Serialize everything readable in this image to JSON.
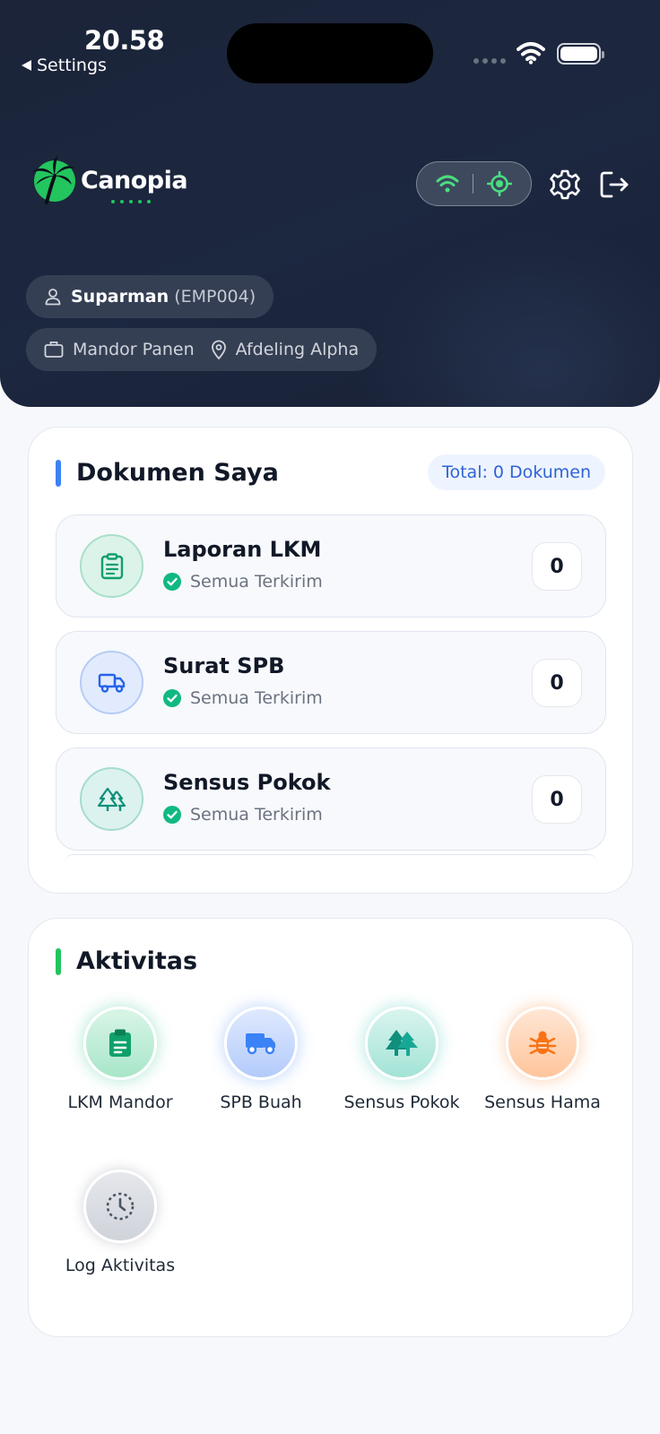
{
  "status_bar": {
    "time": "20.58",
    "back_label": "Settings"
  },
  "app": {
    "name": "Canopia"
  },
  "user": {
    "name": "Suparman",
    "employee_id": "(EMP004)",
    "role": "Mandor Panen",
    "location": "Afdeling Alpha"
  },
  "documents": {
    "title": "Dokumen Saya",
    "total_label": "Total: 0 Dokumen",
    "items": [
      {
        "title": "Laporan LKM",
        "status": "Semua Terkirim",
        "count": "0"
      },
      {
        "title": "Surat SPB",
        "status": "Semua Terkirim",
        "count": "0"
      },
      {
        "title": "Sensus Pokok",
        "status": "Semua Terkirim",
        "count": "0"
      }
    ]
  },
  "activities": {
    "title": "Aktivitas",
    "items": [
      {
        "label": "LKM Mandor",
        "icon": "clipboard-icon"
      },
      {
        "label": "SPB Buah",
        "icon": "truck-icon"
      },
      {
        "label": "Sensus Pokok",
        "icon": "trees-icon"
      },
      {
        "label": "Sensus Hama",
        "icon": "bug-icon"
      },
      {
        "label": "Log Aktivitas",
        "icon": "clock-icon"
      }
    ]
  },
  "colors": {
    "header_bg": "#1b2438",
    "accent_blue": "#3b82f6",
    "accent_green": "#22c55e",
    "teal": "#0f9f8a",
    "orange": "#f97316"
  }
}
